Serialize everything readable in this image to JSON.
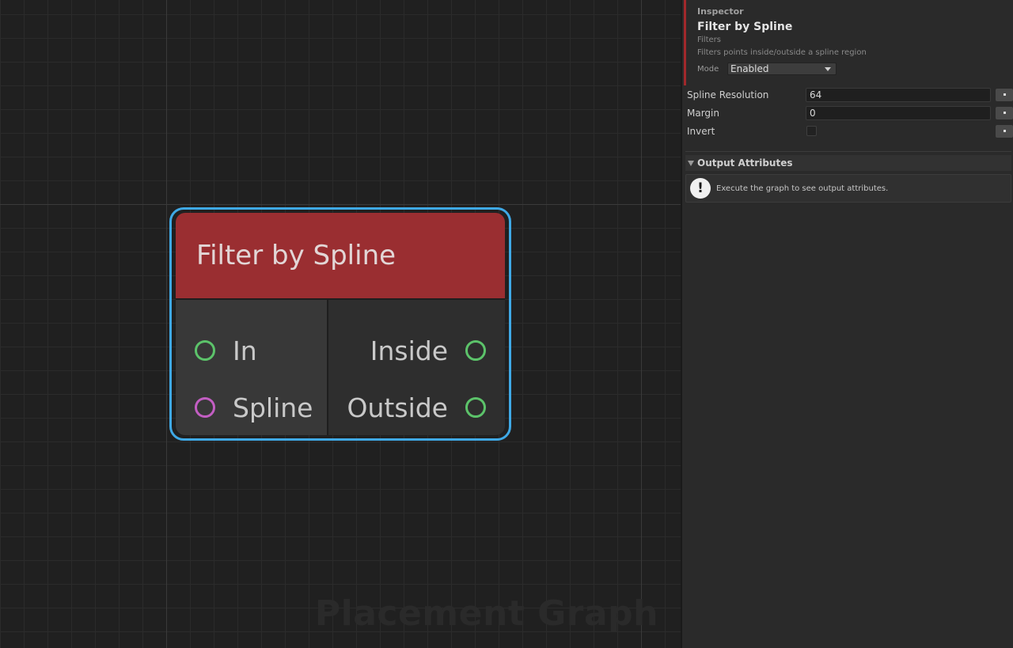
{
  "graph": {
    "watermark": "Placement Graph"
  },
  "node": {
    "title": "Filter by Spline",
    "header_color": "#9a2e31",
    "selection_color": "#3fa9e6",
    "inputs": [
      {
        "label": "In",
        "port_color": "#5cc36a"
      },
      {
        "label": "Spline",
        "port_color": "#c35ec3"
      }
    ],
    "outputs": [
      {
        "label": "Inside",
        "port_color": "#5cc36a"
      },
      {
        "label": "Outside",
        "port_color": "#5cc36a"
      }
    ]
  },
  "inspector": {
    "label": "Inspector",
    "title": "Filter by Spline",
    "category": "Filters",
    "description": "Filters points inside/outside a spline region",
    "mode_label": "Mode",
    "mode_value": "Enabled",
    "properties": [
      {
        "label": "Spline Resolution",
        "value": "64"
      },
      {
        "label": "Margin",
        "value": "0"
      },
      {
        "label": "Invert",
        "checked": false
      }
    ],
    "output_section_title": "Output Attributes",
    "help_icon": "exclamation-icon",
    "help_text": "Execute the graph to see output attributes."
  }
}
